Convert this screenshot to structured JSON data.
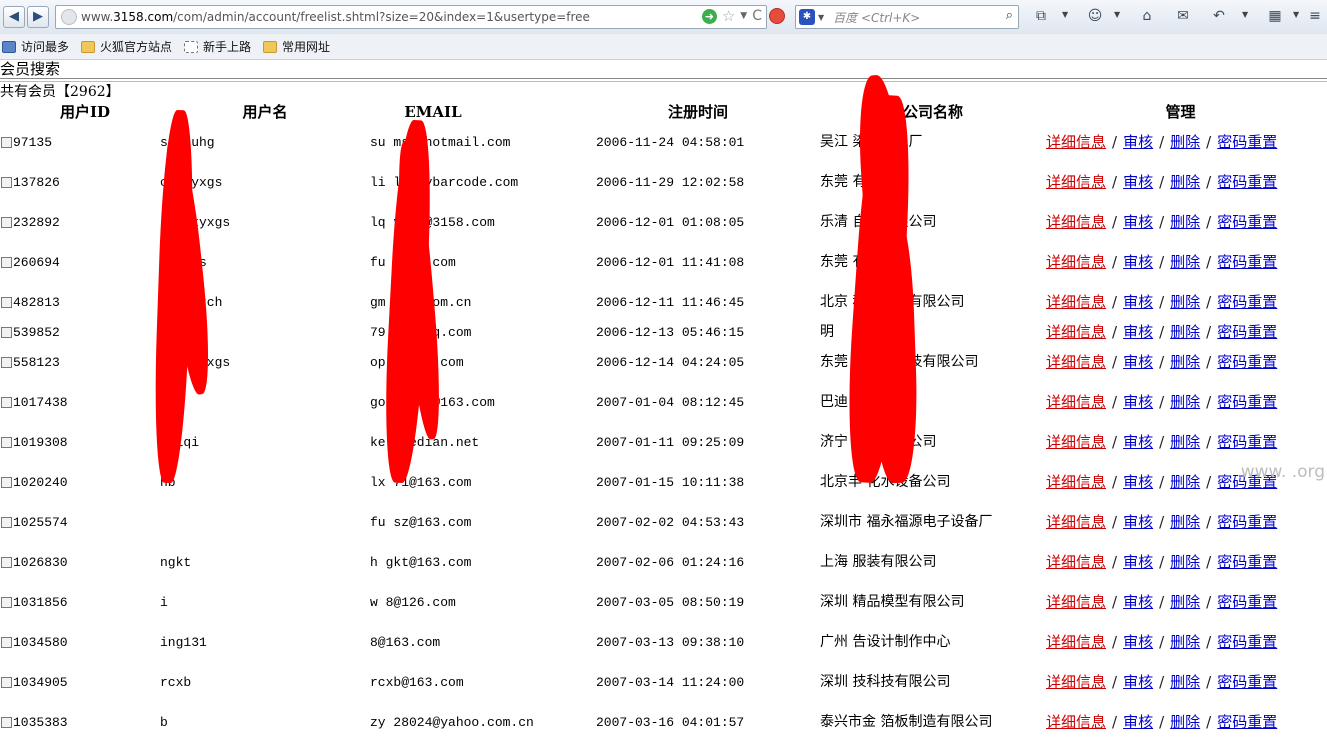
{
  "browser": {
    "url_prefix": "www.",
    "url_domain": "3158.com",
    "url_path": "/com/admin/account/freelist.shtml?size=20&index=1&usertype=free",
    "search_placeholder": "百度 <Ctrl+K>",
    "bookmarks": [
      {
        "label": "访问最多",
        "icon": "star"
      },
      {
        "label": "火狐官方站点",
        "icon": "folder"
      },
      {
        "label": "新手上路",
        "icon": "dashed"
      },
      {
        "label": "常用网址",
        "icon": "folder"
      }
    ]
  },
  "page": {
    "title": "会员搜索",
    "total_prefix": "共有会员【",
    "total_count": "2962",
    "total_suffix": "】"
  },
  "table": {
    "headers": {
      "userid": "用户ID",
      "username": "用户名",
      "email": "EMAIL",
      "regtime": "注册时间",
      "company": "公司名称",
      "manage": "管理"
    },
    "actions": {
      "detail": "详细信息",
      "audit": "审核",
      "delete": "删除",
      "reset": "密码重置",
      "sep": "/"
    },
    "rows": [
      {
        "id": "97135",
        "username": "sa ouhg",
        "email": "su  msn@hotmail.com",
        "time": "2006-11-24 04:58:01",
        "company": "吴江         染料化工厂"
      },
      {
        "id": "137826",
        "username": "c   tmyxgs",
        "email": "li      li@hybarcode.com",
        "time": "2006-11-29 12:02:58",
        "company": "东莞           有限公司"
      },
      {
        "id": "232892",
        "username": "l   tzkyxgs",
        "email": "lq      yxgs@3158.com",
        "time": "2006-12-01 01:08:05",
        "company": "乐清           自控有限公司"
      },
      {
        "id": "260694",
        "username": "    fzyxgs",
        "email": "fu      @163.com",
        "time": "2006-12-01 11:41:08",
        "company": "东莞           有限公司"
      },
      {
        "id": "482813",
        "username": "    denmarch",
        "email": "gm    nsx.com.cn",
        "time": "2006-12-11 11:46:45",
        "company": "北京          科技发展有限公司"
      },
      {
        "id": "539852",
        "username": "      z",
        "email": "79     615@qq.com",
        "time": "2006-12-13 05:46:15",
        "company": "明"
      },
      {
        "id": "558123",
        "username": "    zdhkjyxgs",
        "email": "op     optmv.com",
        "time": "2006-12-14 04:24:05",
        "company": "东莞           自动化科技有限公司"
      },
      {
        "id": "1017438",
        "username": "     e",
        "email": "go     32874@163.com",
        "time": "2007-01-04 08:12:45",
        "company": "巴迪           锁"
      },
      {
        "id": "1019308",
        "username": "    nyiqi",
        "email": "ke     @kedian.net",
        "time": "2007-01-11 09:25:09",
        "company": "济宁           仪器有限公司"
      },
      {
        "id": "1020240",
        "username": "    hb",
        "email": "lx     71@163.com",
        "time": "2007-01-15 10:11:38",
        "company": "北京丰        化水设备公司"
      },
      {
        "id": "1025574",
        "username": "",
        "email": "fu     sz@163.com",
        "time": "2007-02-02 04:53:43",
        "company": "深圳市       福永福源电子设备厂"
      },
      {
        "id": "1026830",
        "username": "    ngkt",
        "email": "h     gkt@163.com",
        "time": "2007-02-06 01:24:16",
        "company": "上海         服装有限公司"
      },
      {
        "id": "1031856",
        "username": "     i",
        "email": "w     8@126.com",
        "time": "2007-03-05 08:50:19",
        "company": "深圳          精品模型有限公司"
      },
      {
        "id": "1034580",
        "username": "     ing131",
        "email": "      8@163.com",
        "time": "2007-03-13 09:38:10",
        "company": "广州          告设计制作中心"
      },
      {
        "id": "1034905",
        "username": "    rcxb",
        "email": "      rcxb@163.com",
        "time": "2007-03-14 11:24:00",
        "company": "深圳          技科技有限公司"
      },
      {
        "id": "1035383",
        "username": "    b",
        "email": "zy   28024@yahoo.com.cn",
        "time": "2007-03-16 04:01:57",
        "company": "泰兴市金      箔板制造有限公司"
      }
    ]
  },
  "watermark": "www.   .org"
}
